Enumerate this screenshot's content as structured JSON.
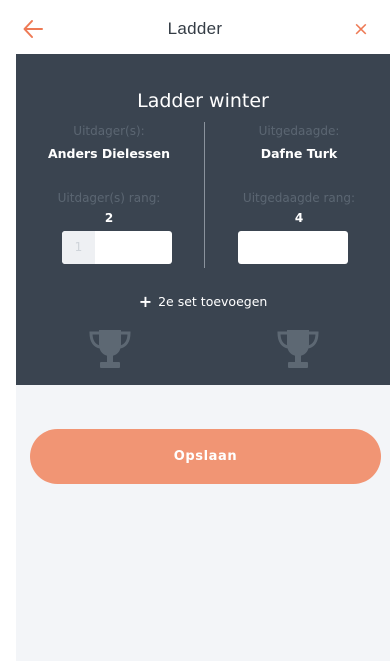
{
  "header": {
    "title": "Ladder",
    "back_icon": "arrow-left-icon",
    "close_symbol": "×",
    "accent_color": "#ee7a55"
  },
  "panel": {
    "ladder_title": "Ladder winter",
    "challenger": {
      "label": "Uitdager(s):",
      "name": "Anders Dielessen",
      "rank_label": "Uitdager(s) rang:",
      "rank": "2",
      "score_placeholder": "1"
    },
    "challenged": {
      "label": "Uitgedaagde:",
      "name": "Dafne Turk",
      "rank_label": "Uitgedaagde rang:",
      "rank": "4"
    },
    "add_set_label": "2e set toevoegen",
    "background_color": "#3a4450"
  },
  "actions": {
    "save_label": "Opslaan",
    "save_color": "#f19574"
  }
}
